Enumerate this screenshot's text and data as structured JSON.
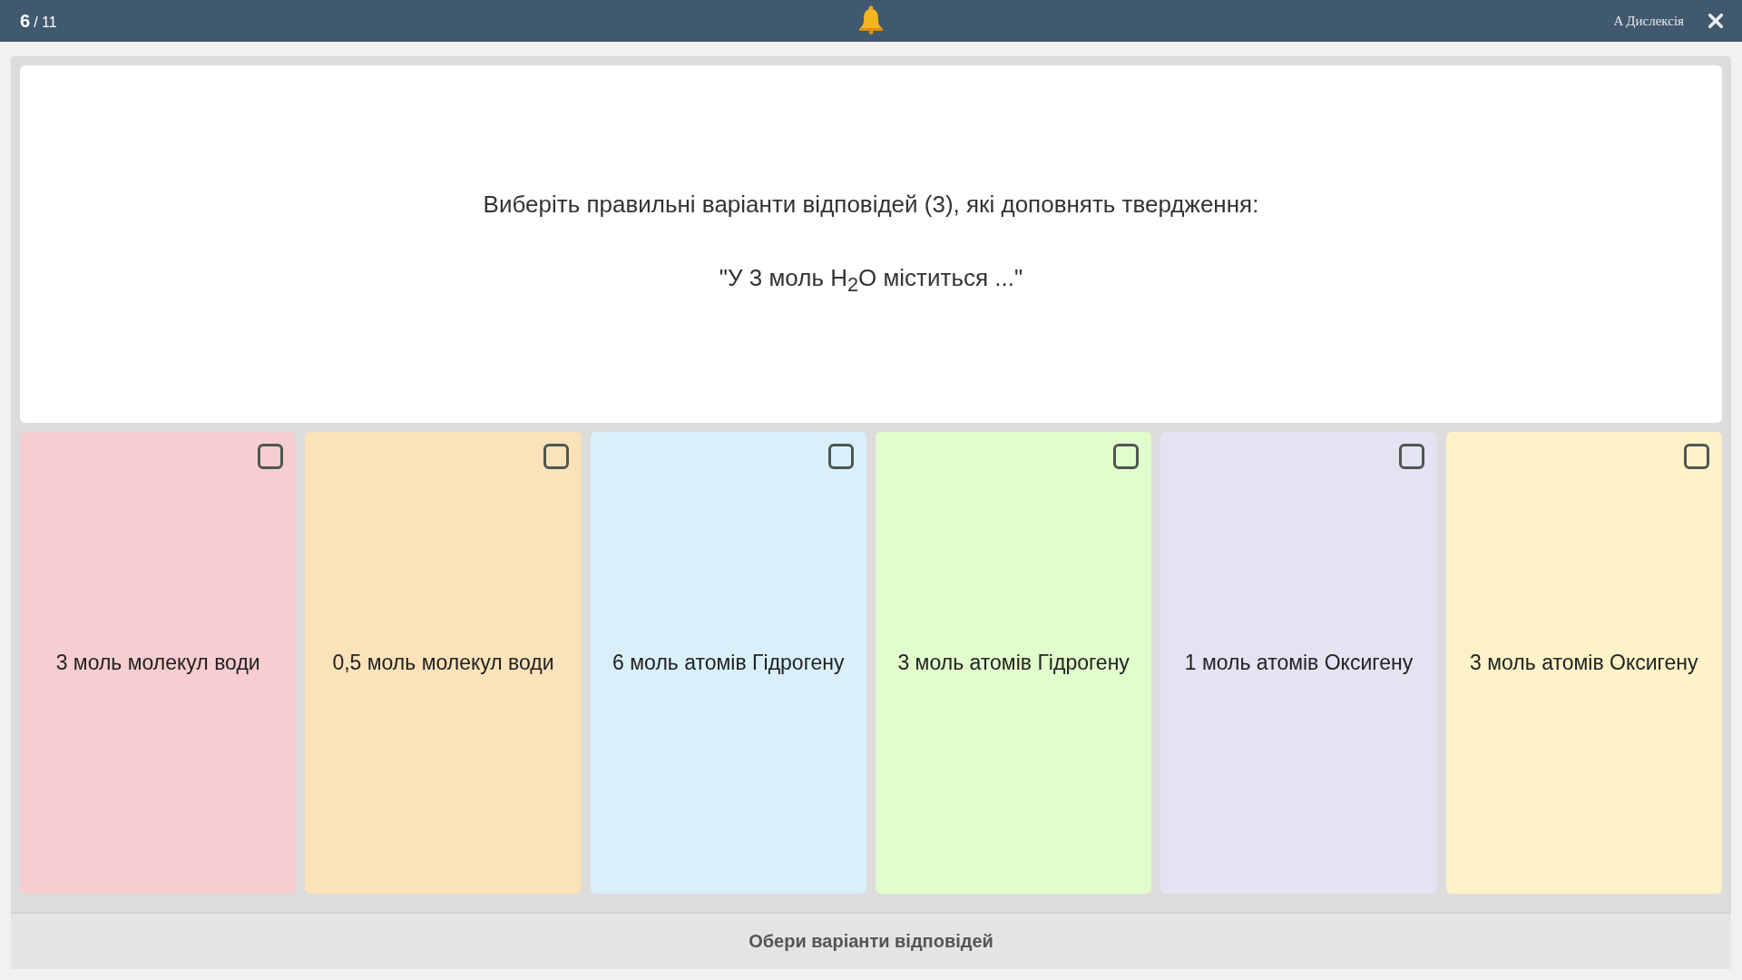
{
  "top_bar": {
    "current": "6",
    "total": "/ 11",
    "dyslexia_button": "A Дислексія"
  },
  "question": {
    "prompt": "Виберіть правильні варіанти відповідей (3), які доповнять твердження:",
    "statement": "\"У 3 моль H$_{2}$O міститься ...\""
  },
  "options": [
    {
      "label": "3 моль молекул води",
      "color": "#f7cdd0",
      "checked": false
    },
    {
      "label": "0,5 моль молекул води",
      "color": "#fbe2b9",
      "checked": false
    },
    {
      "label": "6 моль атомів Гідрогену",
      "color": "#d9f0fb",
      "checked": false
    },
    {
      "label": "3 моль атомів Гідрогену",
      "color": "#e1fdcc",
      "checked": false
    },
    {
      "label": "1 моль атомів Оксигену",
      "color": "#e4e3f1",
      "checked": false
    },
    {
      "label": "3 моль атомів Оксигену",
      "color": "#fdf2c8",
      "checked": false
    }
  ],
  "footer": {
    "hint": "Обери варіанти відповідей"
  }
}
